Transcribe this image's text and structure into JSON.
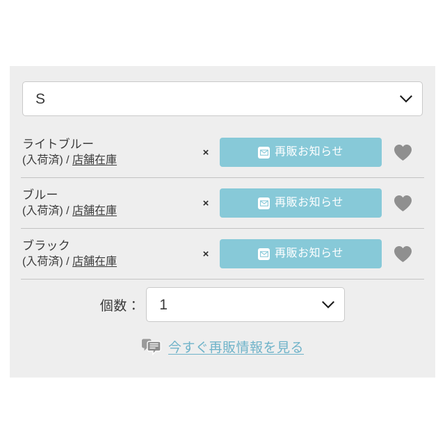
{
  "colors": {
    "panel_bg": "#eeeeee",
    "page_bg": "#ffffff",
    "accent_teal": "#87c9d8",
    "link_teal": "#6fb3c9",
    "heart_gray": "#8f8f8f",
    "text": "#3b3b3b",
    "divider": "#c3c3c3",
    "field_border": "#c9c9c9"
  },
  "size_select": {
    "value": "S",
    "chevron_icon": "chevron-down-icon"
  },
  "variants": [
    {
      "color_name": "ライトブルー",
      "stock_status": "(入荷済)",
      "separator": "/",
      "store_stock_link": "店舗在庫",
      "times_symbol": "×",
      "notify_label": "再販お知らせ",
      "envelope_icon": "envelope-icon",
      "favorite_icon": "heart-icon",
      "favorited": false
    },
    {
      "color_name": "ブルー",
      "stock_status": "(入荷済)",
      "separator": "/",
      "store_stock_link": "店舗在庫",
      "times_symbol": "×",
      "notify_label": "再販お知らせ",
      "envelope_icon": "envelope-icon",
      "favorite_icon": "heart-icon",
      "favorited": false
    },
    {
      "color_name": "ブラック",
      "stock_status": "(入荷済)",
      "separator": "/",
      "store_stock_link": "店舗在庫",
      "times_symbol": "×",
      "notify_label": "再販お知らせ",
      "envelope_icon": "envelope-icon",
      "favorite_icon": "heart-icon",
      "favorited": false
    }
  ],
  "quantity": {
    "label": "個数：",
    "value": "1",
    "chevron_icon": "chevron-down-icon"
  },
  "info_link": {
    "icon": "chat-bubbles-icon",
    "label": "今すぐ再販情報を見る"
  }
}
